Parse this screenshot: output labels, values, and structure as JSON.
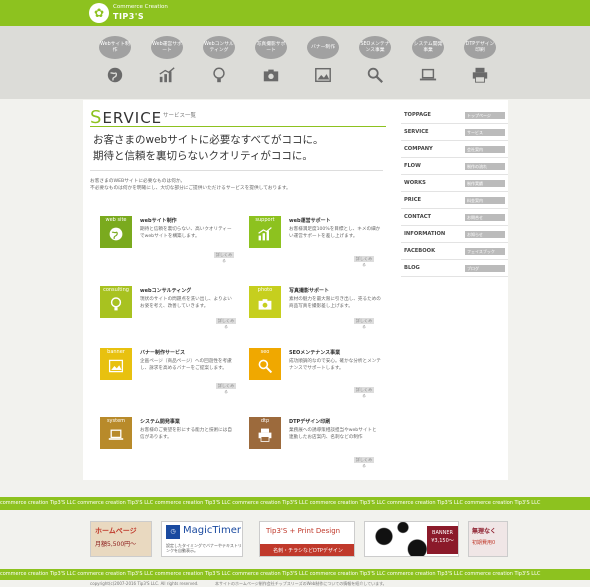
{
  "header": {
    "brand_sub": "Commerce Creation",
    "brand_name": "TIP3'S"
  },
  "nav": [
    {
      "label": "Webサイト制作",
      "icon": "globe-icon"
    },
    {
      "label": "Web運営サポート",
      "icon": "chart-icon"
    },
    {
      "label": "Webコンサルティング",
      "icon": "bulb-icon"
    },
    {
      "label": "写真撮影サポート",
      "icon": "camera-icon"
    },
    {
      "label": "バナー制作",
      "icon": "image-icon"
    },
    {
      "label": "SEOメンテナンス事業",
      "icon": "search-icon"
    },
    {
      "label": "システム開発事業",
      "icon": "laptop-icon"
    },
    {
      "label": "DTPデザイン印刷",
      "icon": "printer-icon"
    }
  ],
  "page": {
    "title_first": "S",
    "title_rest": "ERVICE",
    "subtitle": "サービス一覧",
    "lead1": "お客さまのwebサイトに必要なすべてがココに。",
    "lead2": "期待と信頼を裏切らないクオリティがココに。",
    "intro1": "お客さまのWEBサイトに必要なものは何か。",
    "intro2": "不必要なものは何かを明確にし、大切な部分にご提供いただけるサービスを提供しております。"
  },
  "services": [
    {
      "tag": "web site",
      "title": "webサイト制作",
      "desc": "期待と信頼を裏切らない、高いクオリティーでwebサイトを構築します。",
      "color": "#7aaa1e",
      "more": "詳しくみる"
    },
    {
      "tag": "support",
      "title": "web運営サポート",
      "desc": "お客様満足度100%を目標とし、キメの細かい運営サポートを差し上げます。",
      "color": "#8dc21f",
      "more": "詳しくみる"
    },
    {
      "tag": "consulting",
      "title": "webコンサルティング",
      "desc": "現状のサイトの問題点を洗い出し、よりよいお姿を考え、改善していきます。",
      "color": "#a8c220",
      "more": "詳しくみる"
    },
    {
      "tag": "photo",
      "title": "写真撮影サポート",
      "desc": "素材の魅力を最大限に引き出し、売るための商品写真を撮影差し上げます。",
      "color": "#c6cf1e",
      "more": "詳しくみる"
    },
    {
      "tag": "banner",
      "title": "バナー制作サービス",
      "desc": "企画ページ（商品ページ）への回遊性を考慮し、訴求を高めるバナーをご提案します。",
      "color": "#e8c10f",
      "more": "詳しくみる"
    },
    {
      "tag": "seo",
      "title": "SEOメンテナンス事業",
      "desc": "成功順調的なので安心。確かな分析とメンテナンスでサポートします。",
      "color": "#f0a800",
      "more": "詳しくみる"
    },
    {
      "tag": "system",
      "title": "システム開発事業",
      "desc": "お客様のご要望を形にする能力と技術には自信があります。",
      "color": "#b88a2a",
      "more": "詳しくみる"
    },
    {
      "tag": "dtp",
      "title": "DTPデザイン印刷",
      "desc": "業務展への誘導策相談担当やwebサイトと連動したお店案内、名刺などの制作",
      "color": "#9c6a3c",
      "more": "詳しくみる"
    }
  ],
  "sidebar": [
    {
      "label": "TOPPAGE",
      "sub": "トップページ"
    },
    {
      "label": "SERVICE",
      "sub": "サービス"
    },
    {
      "label": "COMPANY",
      "sub": "会社案内"
    },
    {
      "label": "FLOW",
      "sub": "制作の流れ"
    },
    {
      "label": "WORKS",
      "sub": "制作実績"
    },
    {
      "label": "PRICE",
      "sub": "料金案内"
    },
    {
      "label": "CONTACT",
      "sub": "お問合せ"
    },
    {
      "label": "INFORMATION",
      "sub": "お知らせ"
    },
    {
      "label": "FACEBOOK",
      "sub": "フェイスブック"
    },
    {
      "label": "BLOG",
      "sub": "ブログ"
    }
  ],
  "strip_text": "commerce creation  Tip3'S LLC   commerce creation  Tip3'S LLC   commerce creation  Tip3'S LLC   commerce creation  Tip3'S LLC   commerce creation  Tip3'S LLC   commerce creation  Tip3'S LLC   commerce creation  Tip3'S LLC",
  "banners": [
    {
      "text1": "ホームページ",
      "text2": "月額5,500円〜",
      "bg": "#e9d9c0"
    },
    {
      "text1": "MagicTimer",
      "text2": "設定したタイミングでバナーやテキストリンクを自動表示。",
      "bg": "#ffffff"
    },
    {
      "text1": "Tip3'S + Print Design",
      "text2": "名刺・チラシなどDTPデザイン",
      "bg": "#ffffff"
    },
    {
      "text1": "BANNER",
      "text2": "¥3,150〜",
      "bg": "#ffffff"
    },
    {
      "text1": "無理なく",
      "text2": "初期費用0",
      "bg": "#f0e6e6"
    }
  ],
  "footer": {
    "copyright": "copyright(c)2007-2016 Tip3'S LLC. All rights reserved.",
    "note": "本サイトのホームページ制作会社チップスリーズのWeb制作についての情報を紹介しています。"
  },
  "colors": {
    "brand": "#8dc21f",
    "nav_bg": "#dcdcd8",
    "bubble": "#a1a1a1"
  }
}
